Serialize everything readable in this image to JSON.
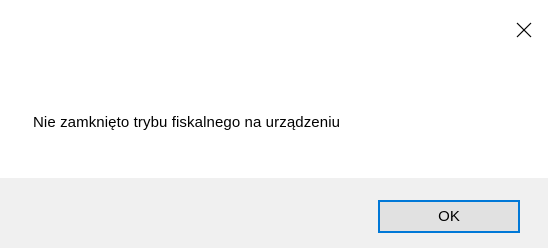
{
  "dialog": {
    "message": "Nie zamknięto trybu fiskalnego na urządzeniu",
    "ok_label": "OK",
    "close_icon": "close-icon"
  },
  "colors": {
    "footer_bg": "#f0f0f0",
    "button_bg": "#e1e1e1",
    "button_focus_border": "#0078d7"
  }
}
